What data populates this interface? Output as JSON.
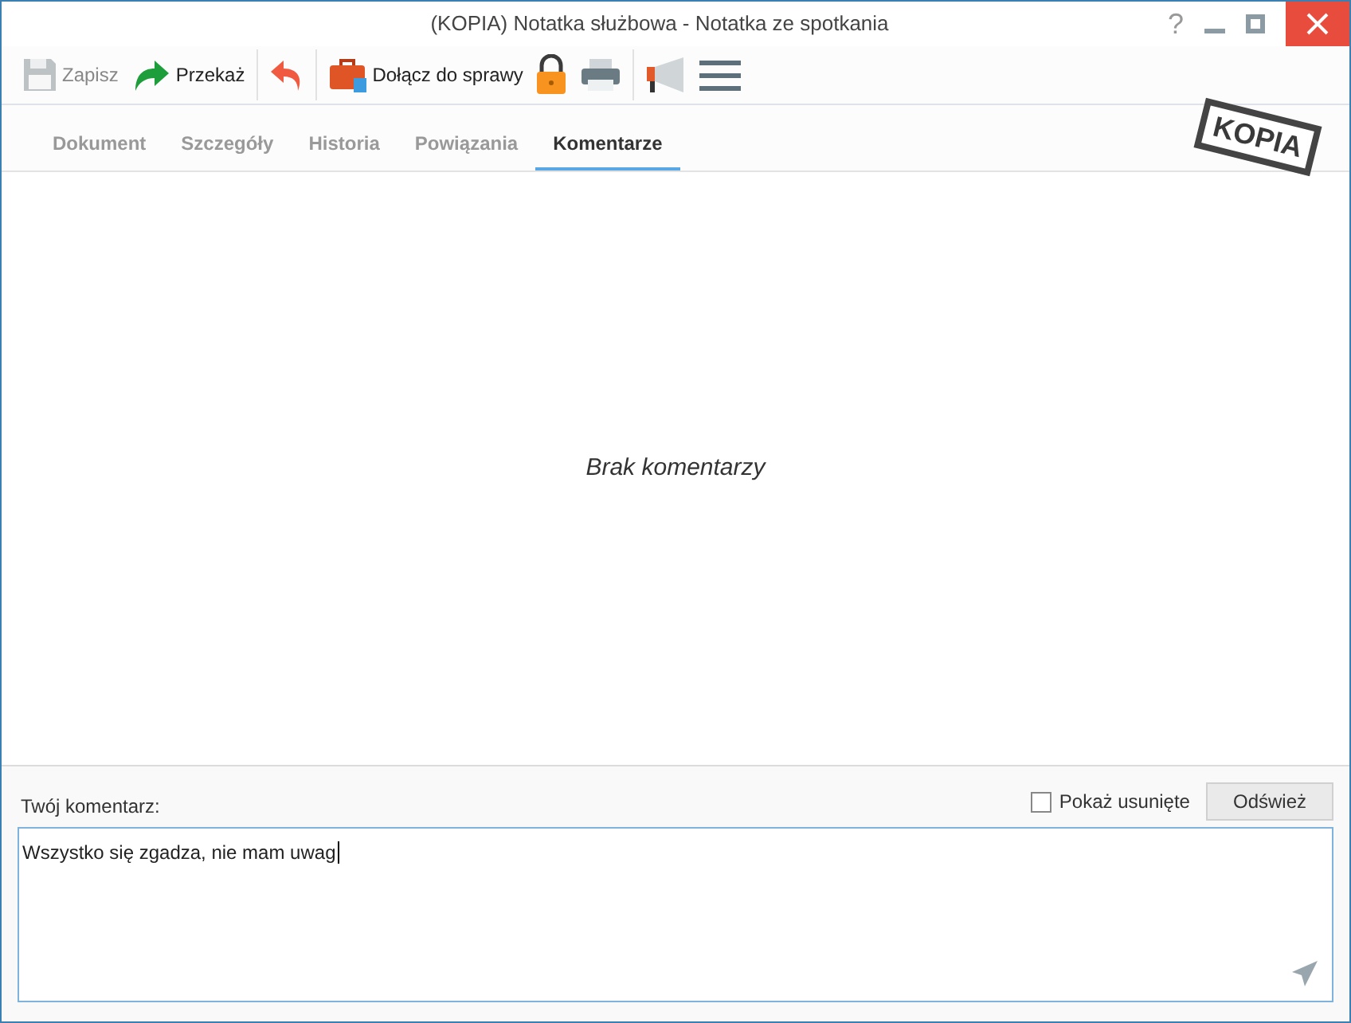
{
  "window": {
    "title": "(KOPIA) Notatka służbowa - Notatka ze spotkania",
    "help": "?"
  },
  "toolbar": [
    {
      "kind": "save",
      "label": "Zapisz",
      "disabled": true,
      "divider_before": false
    },
    {
      "kind": "forward",
      "label": "Przekaż",
      "disabled": false,
      "divider_before": false
    },
    {
      "kind": "undo",
      "disabled": false,
      "divider_before": true
    },
    {
      "kind": "briefcase",
      "label": "Dołącz do sprawy",
      "disabled": false,
      "divider_before": true
    },
    {
      "kind": "lock",
      "disabled": false,
      "divider_before": false
    },
    {
      "kind": "print",
      "disabled": false,
      "divider_before": false
    },
    {
      "kind": "megaphone",
      "disabled": false,
      "divider_before": true
    },
    {
      "kind": "menu",
      "disabled": false,
      "divider_before": false
    }
  ],
  "tabs": [
    {
      "label": "Dokument",
      "selected": false
    },
    {
      "label": "Szczegóły",
      "selected": false
    },
    {
      "label": "Historia",
      "selected": false
    },
    {
      "label": "Powiązania",
      "selected": false
    },
    {
      "label": "Komentarze",
      "selected": true
    }
  ],
  "stamp": "KOPIA",
  "empty_message": "Brak komentarzy",
  "comment_form": {
    "label": "Twój komentarz:",
    "show_deleted": {
      "label": "Pokaż usunięte",
      "checked": false
    },
    "refresh_button": "Odśwież",
    "value": "Wszystko się zgadza, nie mam uwag"
  }
}
